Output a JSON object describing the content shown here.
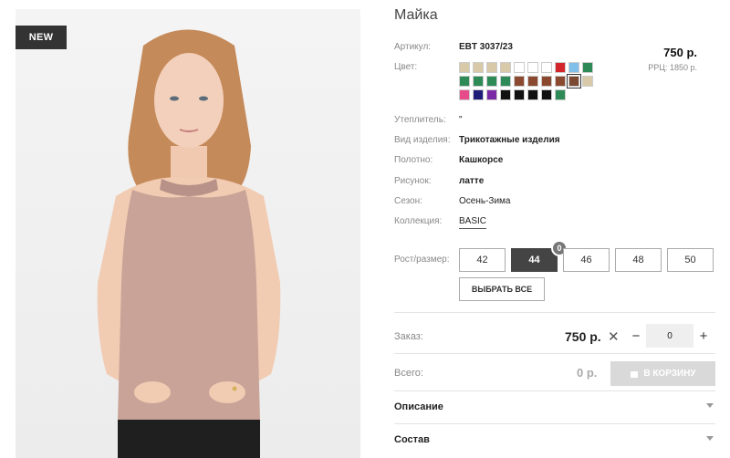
{
  "badge": "NEW",
  "title": "Майка",
  "details": {
    "article_label": "Артикул:",
    "article_value": "EBT 3037/23",
    "color_label": "Цвет:",
    "insulation_label": "Утеплитель:",
    "insulation_value": "\"",
    "type_label": "Вид изделия:",
    "type_value": "Трикотажные изделия",
    "fabric_label": "Полотно:",
    "fabric_value": "Кашкорсе",
    "pattern_label": "Рисунок:",
    "pattern_value": "латте",
    "season_label": "Сезон:",
    "season_value": "Осень-Зима",
    "collection_label": "Коллекция:",
    "collection_value": "BASIC"
  },
  "price": "750 р.",
  "rrp": "РРЦ: 1850 р.",
  "swatch_rows": [
    [
      "#d8c9a8",
      "#d8c9a8",
      "#d8c9a8",
      "#d8c9a8",
      "#ffffff",
      "#ffffff",
      "#ffffff",
      "#d3262a",
      "#7fbfea",
      "#2e8b57"
    ],
    [
      "#2e8b57",
      "#2e8b57",
      "#2e8b57",
      "#2e8b57",
      "#8b4a2f",
      "#8b4a2f",
      "#8b4a2f",
      "#8b4a2f",
      "#7a4a33",
      "#d8c9a8"
    ],
    [
      "#e64c8a",
      "#1e1e7a",
      "#7b2aa6",
      "#111111",
      "#111111",
      "#111111",
      "#111111",
      "#2e8b57"
    ]
  ],
  "selected_swatch": "1-8",
  "sizes_label": "Рост/размер:",
  "sizes": [
    "42",
    "44",
    "46",
    "48",
    "50"
  ],
  "active_size": "44",
  "active_size_count": "0",
  "select_all": "ВЫБРАТЬ ВСЕ",
  "order": {
    "label": "Заказ:",
    "price": "750 р.",
    "times": "✕",
    "minus": "−",
    "plus": "+",
    "qty": "0"
  },
  "total": {
    "label": "Всего:",
    "value": "0 р.",
    "cart_button": "В КОРЗИНУ"
  },
  "accordions": {
    "description": "Описание",
    "composition": "Состав"
  }
}
